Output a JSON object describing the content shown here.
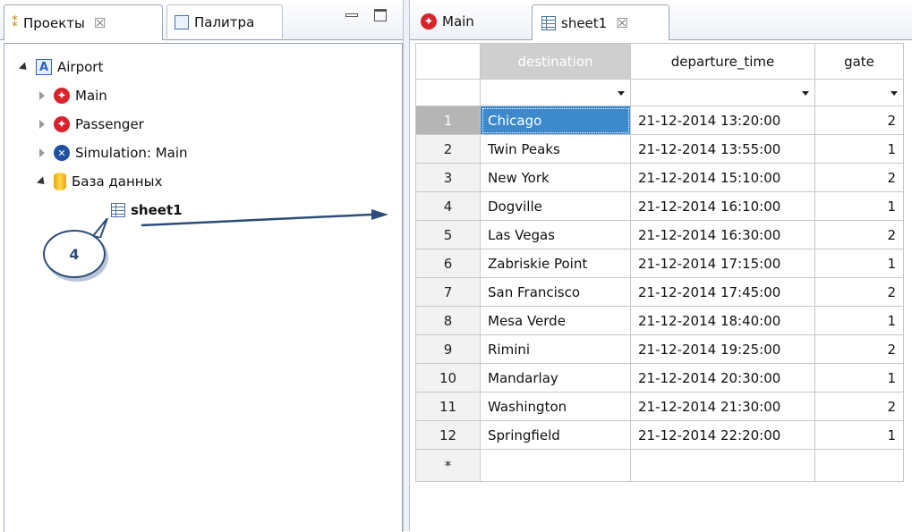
{
  "left": {
    "tabs": [
      {
        "label": "Проекты",
        "close": "☒",
        "icon": "projects-icon"
      },
      {
        "label": "Палитра",
        "icon": "palette-icon"
      }
    ],
    "tree": {
      "root": {
        "label": "Airport",
        "icon": "airport-model-icon"
      },
      "items": [
        {
          "label": "Main",
          "icon": "agent-icon"
        },
        {
          "label": "Passenger",
          "icon": "agent-icon"
        },
        {
          "label": "Simulation: Main",
          "icon": "simulation-icon"
        },
        {
          "label": "База данных",
          "icon": "database-icon"
        },
        {
          "label": "sheet1",
          "icon": "table-icon"
        }
      ]
    },
    "callout": "4"
  },
  "right": {
    "tabs": [
      {
        "label": "Main",
        "icon": "agent-icon"
      },
      {
        "label": "sheet1",
        "close": "☒",
        "icon": "table-icon"
      }
    ],
    "table": {
      "columns": [
        "destination",
        "departure_time",
        "gate"
      ],
      "rows": [
        [
          "1",
          "Chicago",
          "21-12-2014 13:20:00",
          "2"
        ],
        [
          "2",
          "Twin Peaks",
          "21-12-2014 13:55:00",
          "1"
        ],
        [
          "3",
          "New York",
          "21-12-2014 15:10:00",
          "2"
        ],
        [
          "4",
          "Dogville",
          "21-12-2014 16:10:00",
          "1"
        ],
        [
          "5",
          "Las Vegas",
          "21-12-2014 16:30:00",
          "2"
        ],
        [
          "6",
          "Zabriskie Point",
          "21-12-2014 17:15:00",
          "1"
        ],
        [
          "7",
          "San Francisco",
          "21-12-2014 17:45:00",
          "2"
        ],
        [
          "8",
          "Mesa Verde",
          "21-12-2014 18:40:00",
          "1"
        ],
        [
          "9",
          "Rimini",
          "21-12-2014 19:25:00",
          "2"
        ],
        [
          "10",
          "Mandarlay",
          "21-12-2014 20:30:00",
          "1"
        ],
        [
          "11",
          "Washington",
          "21-12-2014 21:30:00",
          "2"
        ],
        [
          "12",
          "Springfield",
          "21-12-2014 22:20:00",
          "1"
        ]
      ],
      "new_row_marker": "*"
    }
  },
  "colors": {
    "selection": "#3d89cc",
    "accent": "#2c4d7a",
    "agent": "#d9232a"
  }
}
